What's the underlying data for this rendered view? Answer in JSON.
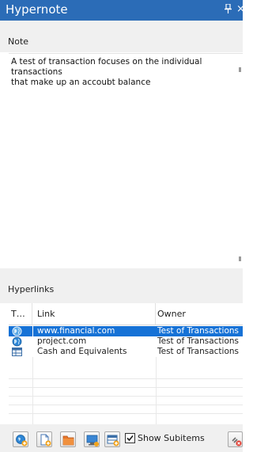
{
  "window": {
    "title": "Hypernote",
    "pin_glyph": "1",
    "close_glyph": "×"
  },
  "note": {
    "label": "Note",
    "text": "A test of transaction focuses on the individual transactions\nthat make up an accoubt balance"
  },
  "hyperlinks": {
    "label": "Hyperlinks",
    "columns": [
      "T…",
      "Link",
      "Owner"
    ],
    "rows": [
      {
        "icon": "globe-icon",
        "link": "www.financial.com",
        "owner": "Test of Transactions",
        "selected": true
      },
      {
        "icon": "globe-icon",
        "link": "project.com",
        "owner": "Test of Transactions",
        "selected": false
      },
      {
        "icon": "table-icon",
        "link": "Cash and Equivalents",
        "owner": "Test of Transactions",
        "selected": false
      }
    ]
  },
  "toolbar": {
    "buttons": [
      "add-web-link-icon",
      "add-document-link-icon",
      "add-folder-link-icon",
      "add-screen-link-icon",
      "add-item-link-icon",
      "remove-link-icon"
    ],
    "show_subitems_label": "Show Subitems",
    "show_subitems_checked": true
  },
  "colors": {
    "titlebar": "#2b6cb7",
    "selection": "#1672d6",
    "panel": "#f0f0f0"
  }
}
